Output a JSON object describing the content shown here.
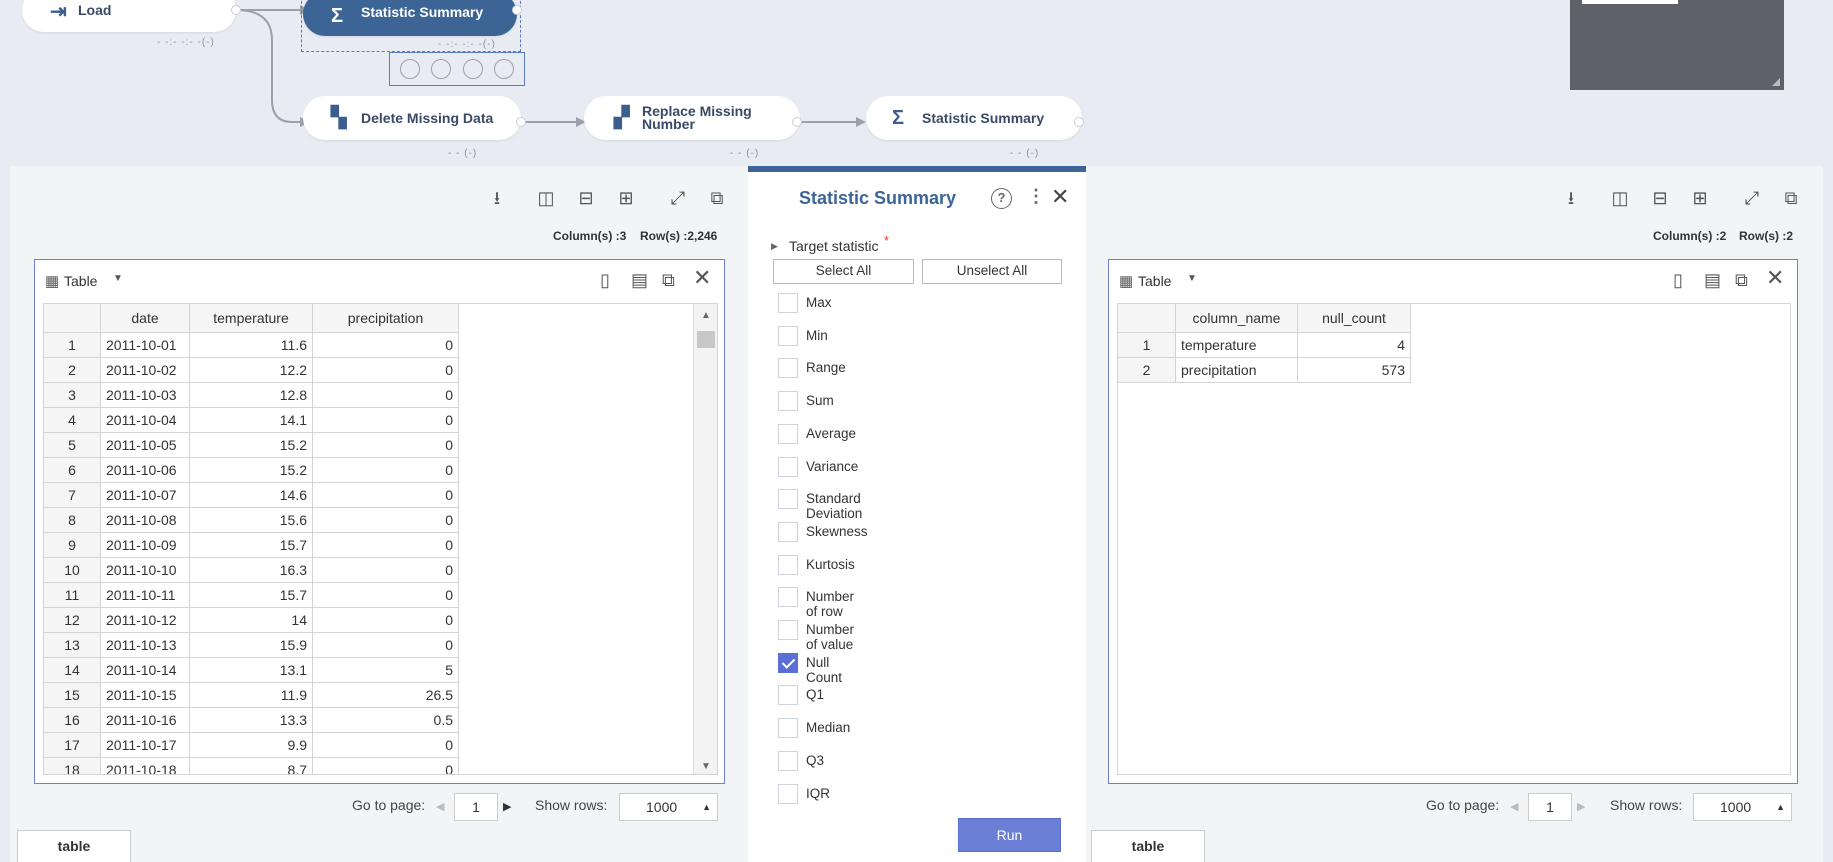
{
  "workflow": {
    "nodes": {
      "load": {
        "label": "Load",
        "sub": "- -:- -:- -(-)"
      },
      "stat_selected": {
        "label": "Statistic Summary",
        "sub": "- -:- -:- -(-)"
      },
      "delete_missing": {
        "label": "Delete Missing Data",
        "sub": "- - (-)"
      },
      "replace_missing": {
        "label_line1": "Replace Missing",
        "label_line2": "Number",
        "sub": "- - (-)"
      },
      "stat_right": {
        "label": "Statistic Summary",
        "sub": "- - (-)"
      }
    }
  },
  "left_panel": {
    "columns_label": "Column(s) :3",
    "rows_label": "Row(s) :2,246",
    "view_label": "Table",
    "headers": [
      "date",
      "temperature",
      "precipitation"
    ],
    "rows": [
      [
        "1",
        "2011-10-01",
        "11.6",
        "0"
      ],
      [
        "2",
        "2011-10-02",
        "12.2",
        "0"
      ],
      [
        "3",
        "2011-10-03",
        "12.8",
        "0"
      ],
      [
        "4",
        "2011-10-04",
        "14.1",
        "0"
      ],
      [
        "5",
        "2011-10-05",
        "15.2",
        "0"
      ],
      [
        "6",
        "2011-10-06",
        "15.2",
        "0"
      ],
      [
        "7",
        "2011-10-07",
        "14.6",
        "0"
      ],
      [
        "8",
        "2011-10-08",
        "15.6",
        "0"
      ],
      [
        "9",
        "2011-10-09",
        "15.7",
        "0"
      ],
      [
        "10",
        "2011-10-10",
        "16.3",
        "0"
      ],
      [
        "11",
        "2011-10-11",
        "15.7",
        "0"
      ],
      [
        "12",
        "2011-10-12",
        "14",
        "0"
      ],
      [
        "13",
        "2011-10-13",
        "15.9",
        "0"
      ],
      [
        "14",
        "2011-10-14",
        "13.1",
        "5"
      ],
      [
        "15",
        "2011-10-15",
        "11.9",
        "26.5"
      ],
      [
        "16",
        "2011-10-16",
        "13.3",
        "0.5"
      ],
      [
        "17",
        "2011-10-17",
        "9.9",
        "0"
      ],
      [
        "18",
        "2011-10-18",
        "8.7",
        "0"
      ]
    ],
    "go_to_page_label": "Go to page:",
    "page": "1",
    "show_rows_label": "Show rows:",
    "show_rows": "1000",
    "tab": "table"
  },
  "dialog": {
    "title": "Statistic Summary",
    "section_label": "Target statistic",
    "required_mark": "*",
    "select_all": "Select All",
    "unselect_all": "Unselect All",
    "options": [
      {
        "label": "Max",
        "checked": false
      },
      {
        "label": "Min",
        "checked": false
      },
      {
        "label": "Range",
        "checked": false
      },
      {
        "label": "Sum",
        "checked": false
      },
      {
        "label": "Average",
        "checked": false
      },
      {
        "label": "Variance",
        "checked": false
      },
      {
        "label": "Standard Deviation",
        "checked": false
      },
      {
        "label": "Skewness",
        "checked": false
      },
      {
        "label": "Kurtosis",
        "checked": false
      },
      {
        "label": "Number of row",
        "checked": false
      },
      {
        "label": "Number of value",
        "checked": false
      },
      {
        "label": "Null Count",
        "checked": true
      },
      {
        "label": "Q1",
        "checked": false
      },
      {
        "label": "Median",
        "checked": false
      },
      {
        "label": "Q3",
        "checked": false
      },
      {
        "label": "IQR",
        "checked": false
      }
    ],
    "run_label": "Run"
  },
  "right_panel": {
    "columns_label": "Column(s) :2",
    "rows_label": "Row(s) :2",
    "view_label": "Table",
    "headers": [
      "column_name",
      "null_count"
    ],
    "rows": [
      [
        "1",
        "temperature",
        "4"
      ],
      [
        "2",
        "precipitation",
        "573"
      ]
    ],
    "go_to_page_label": "Go to page:",
    "page": "1",
    "show_rows_label": "Show rows:",
    "show_rows": "1000",
    "tab": "table"
  },
  "colors": {
    "accent": "#3c6596",
    "selected_node": "#3c6596",
    "run_button": "#6b7fd6",
    "checkbox_on": "#5a6fd6"
  }
}
